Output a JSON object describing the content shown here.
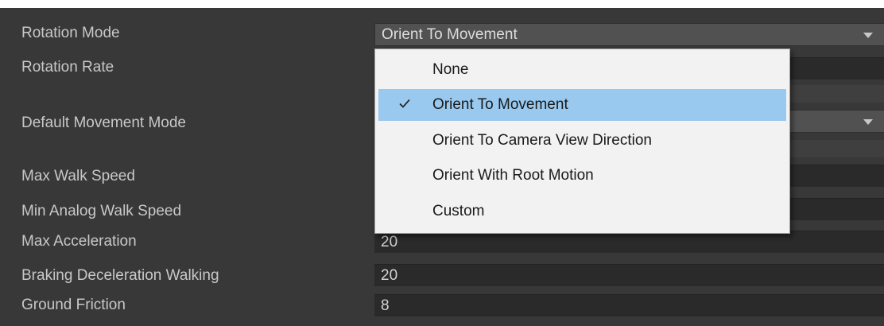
{
  "labels": {
    "rotation_mode": "Rotation Mode",
    "rotation_rate": "Rotation Rate",
    "default_movement_mode": "Default Movement Mode",
    "max_walk_speed": "Max Walk Speed",
    "min_analog_walk_speed": "Min Analog Walk Speed",
    "max_acceleration": "Max Acceleration",
    "braking_deceleration_walking": "Braking Deceleration Walking",
    "ground_friction": "Ground Friction"
  },
  "fields": {
    "rotation_mode": "Orient To Movement",
    "max_acceleration": "20",
    "braking_deceleration_walking": "20",
    "ground_friction": "8"
  },
  "rotation_mode_menu": {
    "items": [
      {
        "label": "None",
        "checked": false
      },
      {
        "label": "Orient To Movement",
        "checked": true
      },
      {
        "label": "Orient To Camera View Direction",
        "checked": false
      },
      {
        "label": "Orient With Root Motion",
        "checked": false
      },
      {
        "label": "Custom",
        "checked": false
      }
    ],
    "highlight_color": "#99c9ef"
  },
  "icons": {
    "dropdown_caret": "chevron-down-icon",
    "checkmark": "checkmark-icon"
  },
  "colors": {
    "panel_bg": "#383838",
    "field_bg": "#2a2a2a",
    "dropdown_bg": "#515151",
    "menu_bg": "#f2f2f2"
  }
}
